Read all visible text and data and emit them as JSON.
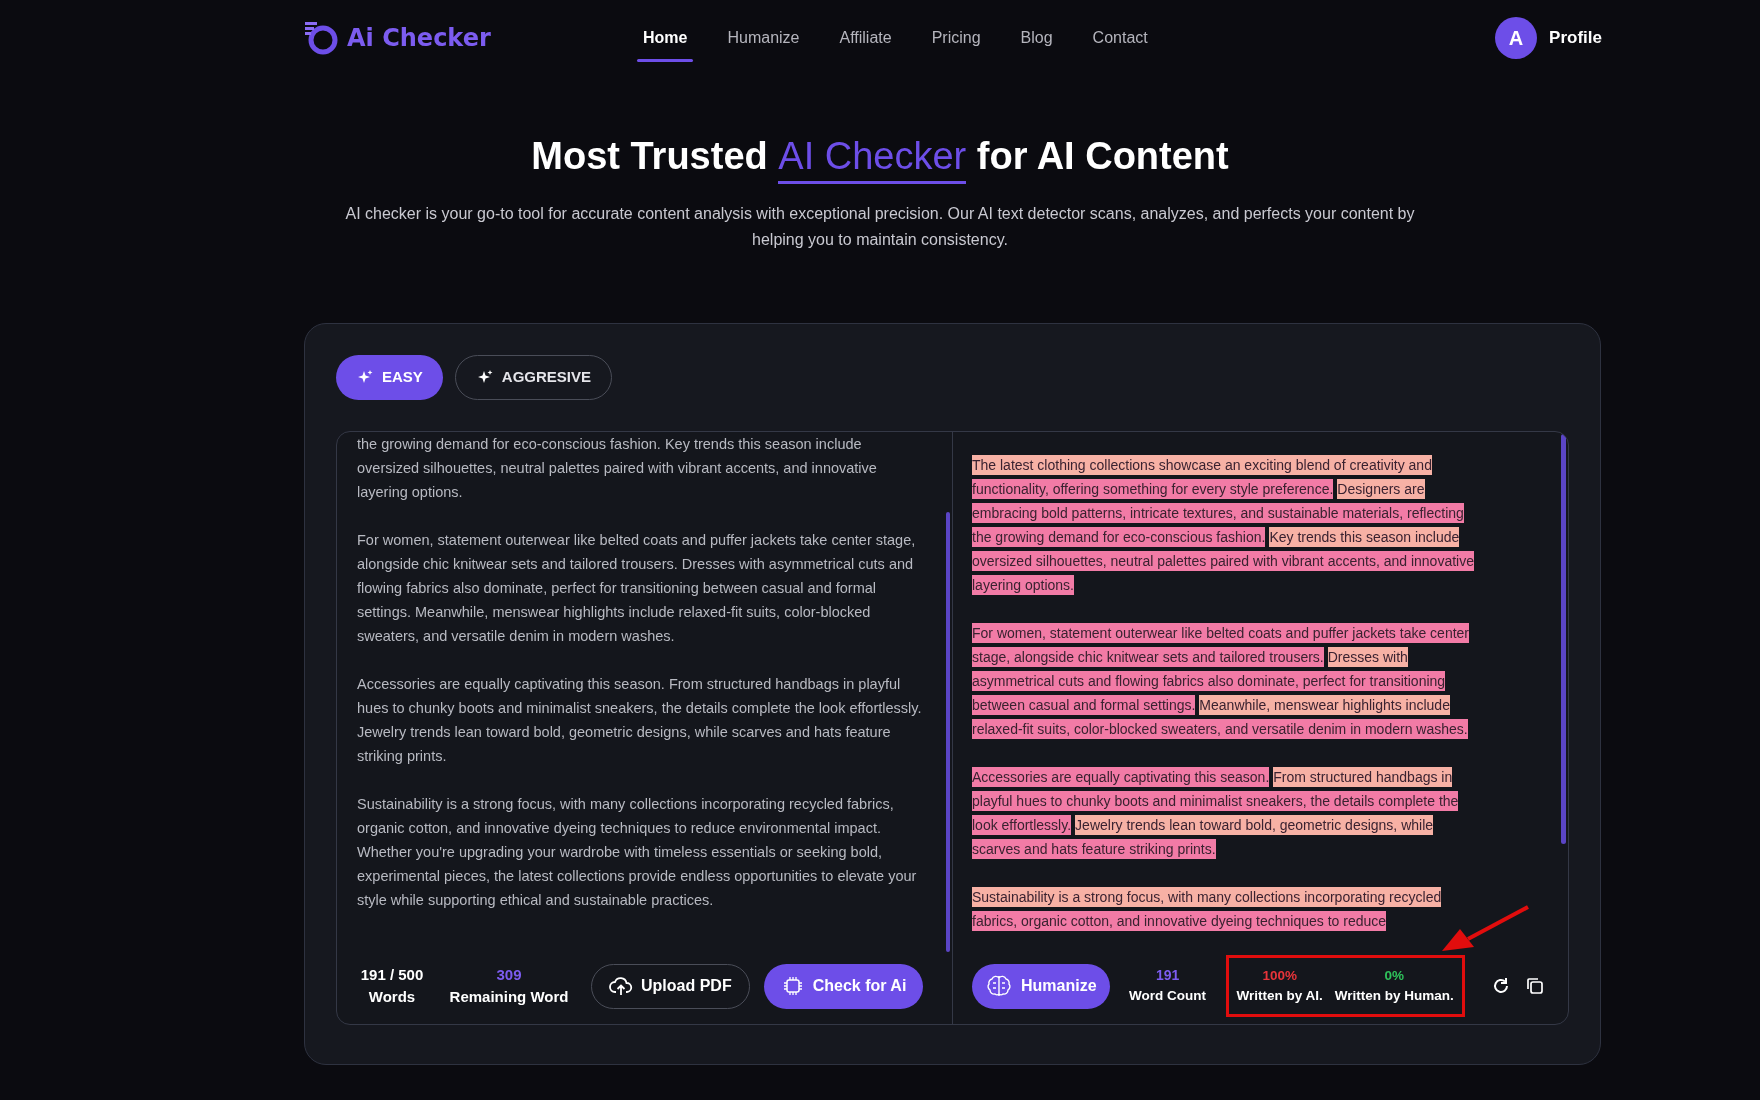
{
  "brand": "Ai Checker",
  "nav": [
    {
      "label": "Home",
      "selected": true
    },
    {
      "label": "Humanize",
      "selected": false
    },
    {
      "label": "Affiliate",
      "selected": false
    },
    {
      "label": "Pricing",
      "selected": false
    },
    {
      "label": "Blog",
      "selected": false
    },
    {
      "label": "Contact",
      "selected": false
    }
  ],
  "profile": {
    "initial": "A",
    "label": "Profile"
  },
  "hero": {
    "title_before": "Most Trusted ",
    "title_highlight": "AI Checker",
    "title_after": " for AI Content",
    "subtitle": "AI checker is your go-to tool for accurate content analysis with exceptional precision. Our AI text detector scans, analyzes, and perfects your content by helping you to maintain consistency."
  },
  "modes": [
    {
      "label": "EASY",
      "selected": true
    },
    {
      "label": "AGGRESIVE",
      "selected": false
    }
  ],
  "input_paragraphs": [
    "the growing demand for eco-conscious fashion. Key trends this season include oversized silhouettes, neutral palettes paired with vibrant accents, and innovative layering options.",
    "For women, statement outerwear like belted coats and puffer jackets take center stage, alongside chic knitwear sets and tailored trousers. Dresses with asymmetrical cuts and flowing fabrics also dominate, perfect for transitioning between casual and formal settings. Meanwhile, menswear highlights include relaxed-fit suits, color-blocked sweaters, and versatile denim in modern washes.",
    "Accessories are equally captivating this season. From structured handbags in playful hues to chunky boots and minimalist sneakers, the details complete the look effortlessly. Jewelry trends lean toward bold, geometric designs, while scarves and hats feature striking prints.",
    "Sustainability is a strong focus, with many collections incorporating recycled fabrics, organic cotton, and innovative dyeing techniques to reduce environmental impact. Whether you're upgrading your wardrobe with timeless essentials or seeking bold, experimental pieces, the latest collections provide endless opportunities to elevate your style while supporting ethical and sustainable practices."
  ],
  "result_paragraphs": [
    [
      [
        {
          "text": "The latest clothing collections showcase an exciting blend of creativity and",
          "color": "#f7b1a5"
        }
      ],
      [
        {
          "text": "functionality, offering something for every style preference.",
          "color": "#f27ba6"
        },
        {
          "text": "Designers are",
          "color": "#f7b1a5"
        }
      ],
      [
        {
          "text": "embracing bold patterns, intricate textures, and sustainable materials, reflecting",
          "color": "#f27ba6"
        }
      ],
      [
        {
          "text": "the growing demand for eco-conscious fashion.",
          "color": "#f27ba6"
        },
        {
          "text": "Key trends this season include",
          "color": "#f7b1a5"
        }
      ],
      [
        {
          "text": "oversized silhouettes, neutral palettes paired with vibrant accents, and innovative",
          "color": "#f27ba6"
        }
      ],
      [
        {
          "text": "layering options.",
          "color": "#f27ba6"
        }
      ]
    ],
    [
      [
        {
          "text": "For women, statement outerwear like belted coats and puffer jackets take center",
          "color": "#f27ba6"
        }
      ],
      [
        {
          "text": "stage, alongside chic knitwear sets and tailored trousers.",
          "color": "#f27ba6"
        },
        {
          "text": "Dresses with",
          "color": "#f7b1a5"
        }
      ],
      [
        {
          "text": "asymmetrical cuts and flowing fabrics also dominate, perfect for transitioning",
          "color": "#f27ba6"
        }
      ],
      [
        {
          "text": "between casual and formal settings.",
          "color": "#f27ba6"
        },
        {
          "text": "Meanwhile, menswear highlights include",
          "color": "#f7b1a5"
        }
      ],
      [
        {
          "text": "relaxed-fit suits, color-blocked sweaters, and versatile denim in modern washes.",
          "color": "#f27ba6"
        }
      ]
    ],
    [
      [
        {
          "text": "Accessories are equally captivating this season.",
          "color": "#f27ba6"
        },
        {
          "text": "From structured handbags in",
          "color": "#f7b1a5"
        }
      ],
      [
        {
          "text": "playful hues to chunky boots and minimalist sneakers, the details complete the",
          "color": "#f27ba6"
        }
      ],
      [
        {
          "text": "look effortlessly.",
          "color": "#f27ba6"
        },
        {
          "text": "Jewelry trends lean toward bold, geometric designs, while",
          "color": "#f7b1a5"
        }
      ],
      [
        {
          "text": "scarves and hats feature striking prints.",
          "color": "#f27ba6"
        }
      ]
    ],
    [
      [
        {
          "text": "Sustainability is a strong focus, with many collections incorporating recycled",
          "color": "#f7b1a5"
        }
      ],
      [
        {
          "text": "fabrics, organic cotton, and innovative dyeing techniques to reduce",
          "color": "#f27ba6"
        }
      ]
    ]
  ],
  "left_footer": {
    "count": "191 / 500",
    "count_label": "Words",
    "remaining": "309",
    "remaining_label": "Remaining Word",
    "upload": "Upload PDF",
    "check": "Check for Ai"
  },
  "right_footer": {
    "humanize": "Humanize",
    "word_count": "191",
    "word_count_label": "Word Count",
    "ai_percent": "100%",
    "ai_label": "Written by AI.",
    "human_percent": "0%",
    "human_label": "Written by Human."
  }
}
